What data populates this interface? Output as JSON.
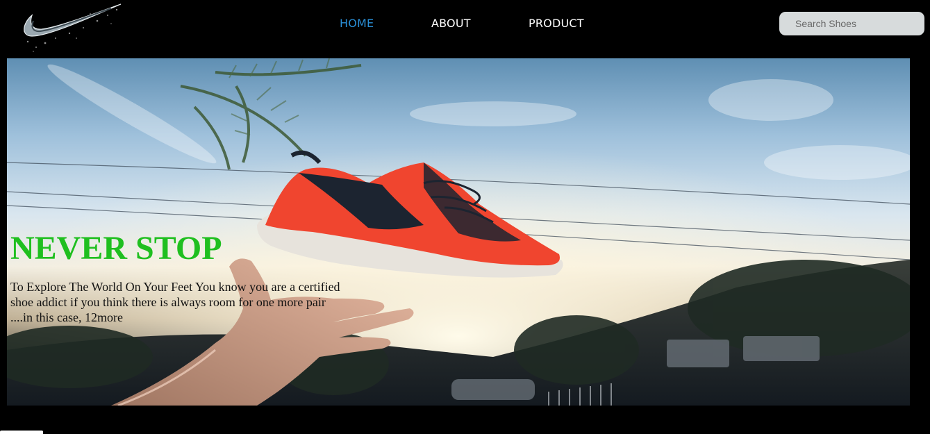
{
  "brand": {
    "logo_icon": "swoosh-logo-icon"
  },
  "nav": {
    "items": [
      {
        "label": "HOME",
        "active": true
      },
      {
        "label": "ABOUT",
        "active": false
      },
      {
        "label": "PRODUCT",
        "active": false
      }
    ],
    "active_color": "#2a8fd6"
  },
  "search": {
    "placeholder": "Search Shoes",
    "value": ""
  },
  "hero": {
    "title": "NEVER STOP",
    "title_color": "#1fbf1f",
    "text": "To Explore The World On Your Feet You know you are a certified shoe addict if you think there is always room for one more pair ....in this case, 12more"
  }
}
